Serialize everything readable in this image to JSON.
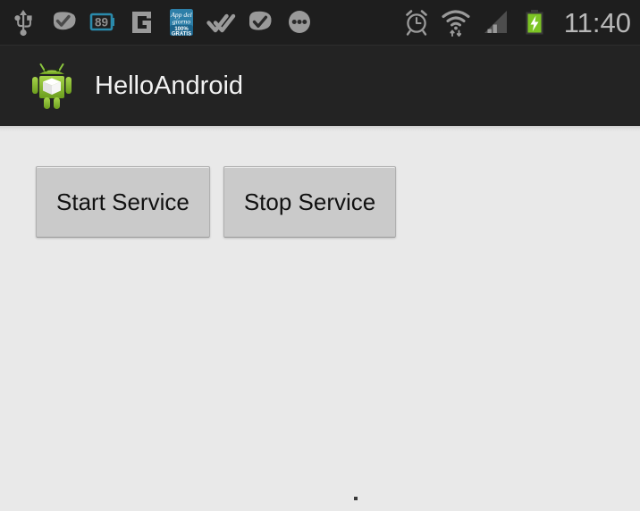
{
  "status_bar": {
    "background_color": "#1e1e1e",
    "clock": "11:40",
    "notification_icons": [
      {
        "name": "usb-icon",
        "label": "USB connected"
      },
      {
        "name": "check-badge-icon",
        "label": "Notification check"
      },
      {
        "name": "counter-89-icon",
        "label": "89",
        "accent_color": "#2a8aab"
      },
      {
        "name": "g-logo-icon",
        "label": "G"
      },
      {
        "name": "app-del-giorno-icon",
        "line1": "App del",
        "line2": "giorno",
        "line3": "100%",
        "line4": "GRATIS",
        "accent_color": "#1d6f96"
      },
      {
        "name": "double-check-icon",
        "label": "Double check"
      },
      {
        "name": "check-circle-icon",
        "label": "Check circle"
      },
      {
        "name": "more-dots-icon",
        "label": "More"
      }
    ],
    "system_icons": [
      {
        "name": "alarm-clock-icon",
        "label": "Alarm set"
      },
      {
        "name": "wifi-data-icon",
        "label": "Wi-Fi with data transfer"
      },
      {
        "name": "cell-signal-icon",
        "label": "Cellular signal",
        "bars_active": 2,
        "bars_total": 4
      },
      {
        "name": "battery-charging-icon",
        "label": "Battery charging",
        "color": "#7cc424"
      }
    ]
  },
  "action_bar": {
    "background_color": "#232323",
    "app_icon_name": "android-robot-icon",
    "title": "HelloAndroid"
  },
  "content": {
    "background_color": "#e9e9e9",
    "buttons": [
      {
        "name": "start-service-button",
        "label": "Start Service"
      },
      {
        "name": "stop-service-button",
        "label": "Stop Service"
      }
    ]
  }
}
